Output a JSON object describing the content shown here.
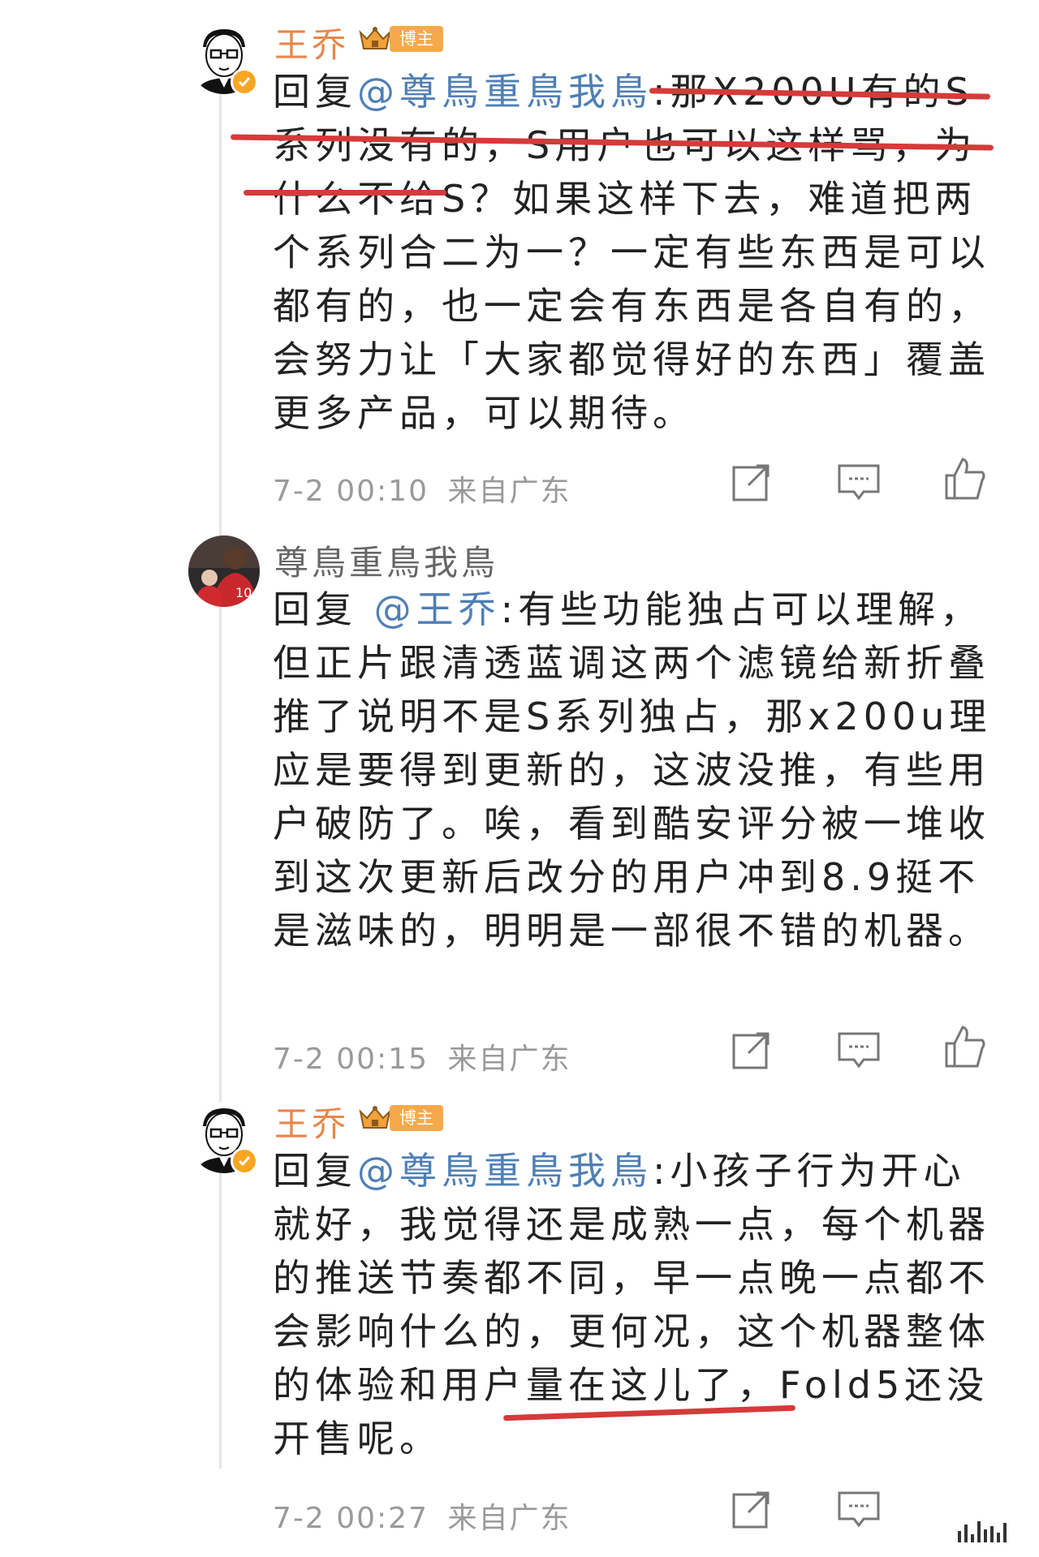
{
  "colors": {
    "username_blogger": "#e8864a",
    "username_user": "#666666",
    "mention": "#4f7fb5",
    "timestamp": "#9a9a9a",
    "badge_bg": "#f5a94a",
    "highlight_line": "#d63a3a"
  },
  "comments": [
    {
      "username": "王乔",
      "badge": "博主",
      "reply_prefix": "回复",
      "mention": "@尊鳥重鳥我鳥",
      "text": ":那X200U有的S系列没有的，S用户也可以这样骂，为什么不给S？如果这样下去，难道把两个系列合二为一？一定有些东西是可以都有的，也一定会有东西是各自有的，会努力让「大家都觉得好的东西」覆盖更多产品，可以期待。",
      "time": "7-2 00:10",
      "location": "来自广东",
      "icons": [
        "avatar-cartoon",
        "verified-icon",
        "crown-icon",
        "share-icon",
        "comment-icon",
        "like-icon"
      ]
    },
    {
      "username": "尊鳥重鳥我鳥",
      "reply_prefix": "回复 ",
      "mention": "@王乔",
      "text": ":有些功能独占可以理解，但正片跟清透蓝调这两个滤镜给新折叠推了说明不是S系列独占，那x200u理应是要得到更新的，这波没推，有些用户破防了。唉，看到酷安评分被一堆收到这次更新后改分的用户冲到8.9挺不是滋味的，明明是一部很不错的机器。",
      "time": "7-2 00:15",
      "location": "来自广东",
      "icons": [
        "avatar-photo",
        "share-icon",
        "comment-icon",
        "like-icon"
      ]
    },
    {
      "username": "王乔",
      "badge": "博主",
      "reply_prefix": "回复",
      "mention": "@尊鳥重鳥我鳥",
      "text": ":小孩子行为开心就好，我觉得还是成熟一点，每个机器的推送节奏都不同，早一点晚一点都不会影响什么的，更何况，这个机器整体的体验和用户量在这儿了，Fold5还没开售呢。",
      "time": "7-2 00:27",
      "location": "来自广东",
      "icons": [
        "avatar-cartoon",
        "verified-icon",
        "crown-icon",
        "share-icon",
        "comment-icon",
        "like-icon"
      ]
    }
  ]
}
